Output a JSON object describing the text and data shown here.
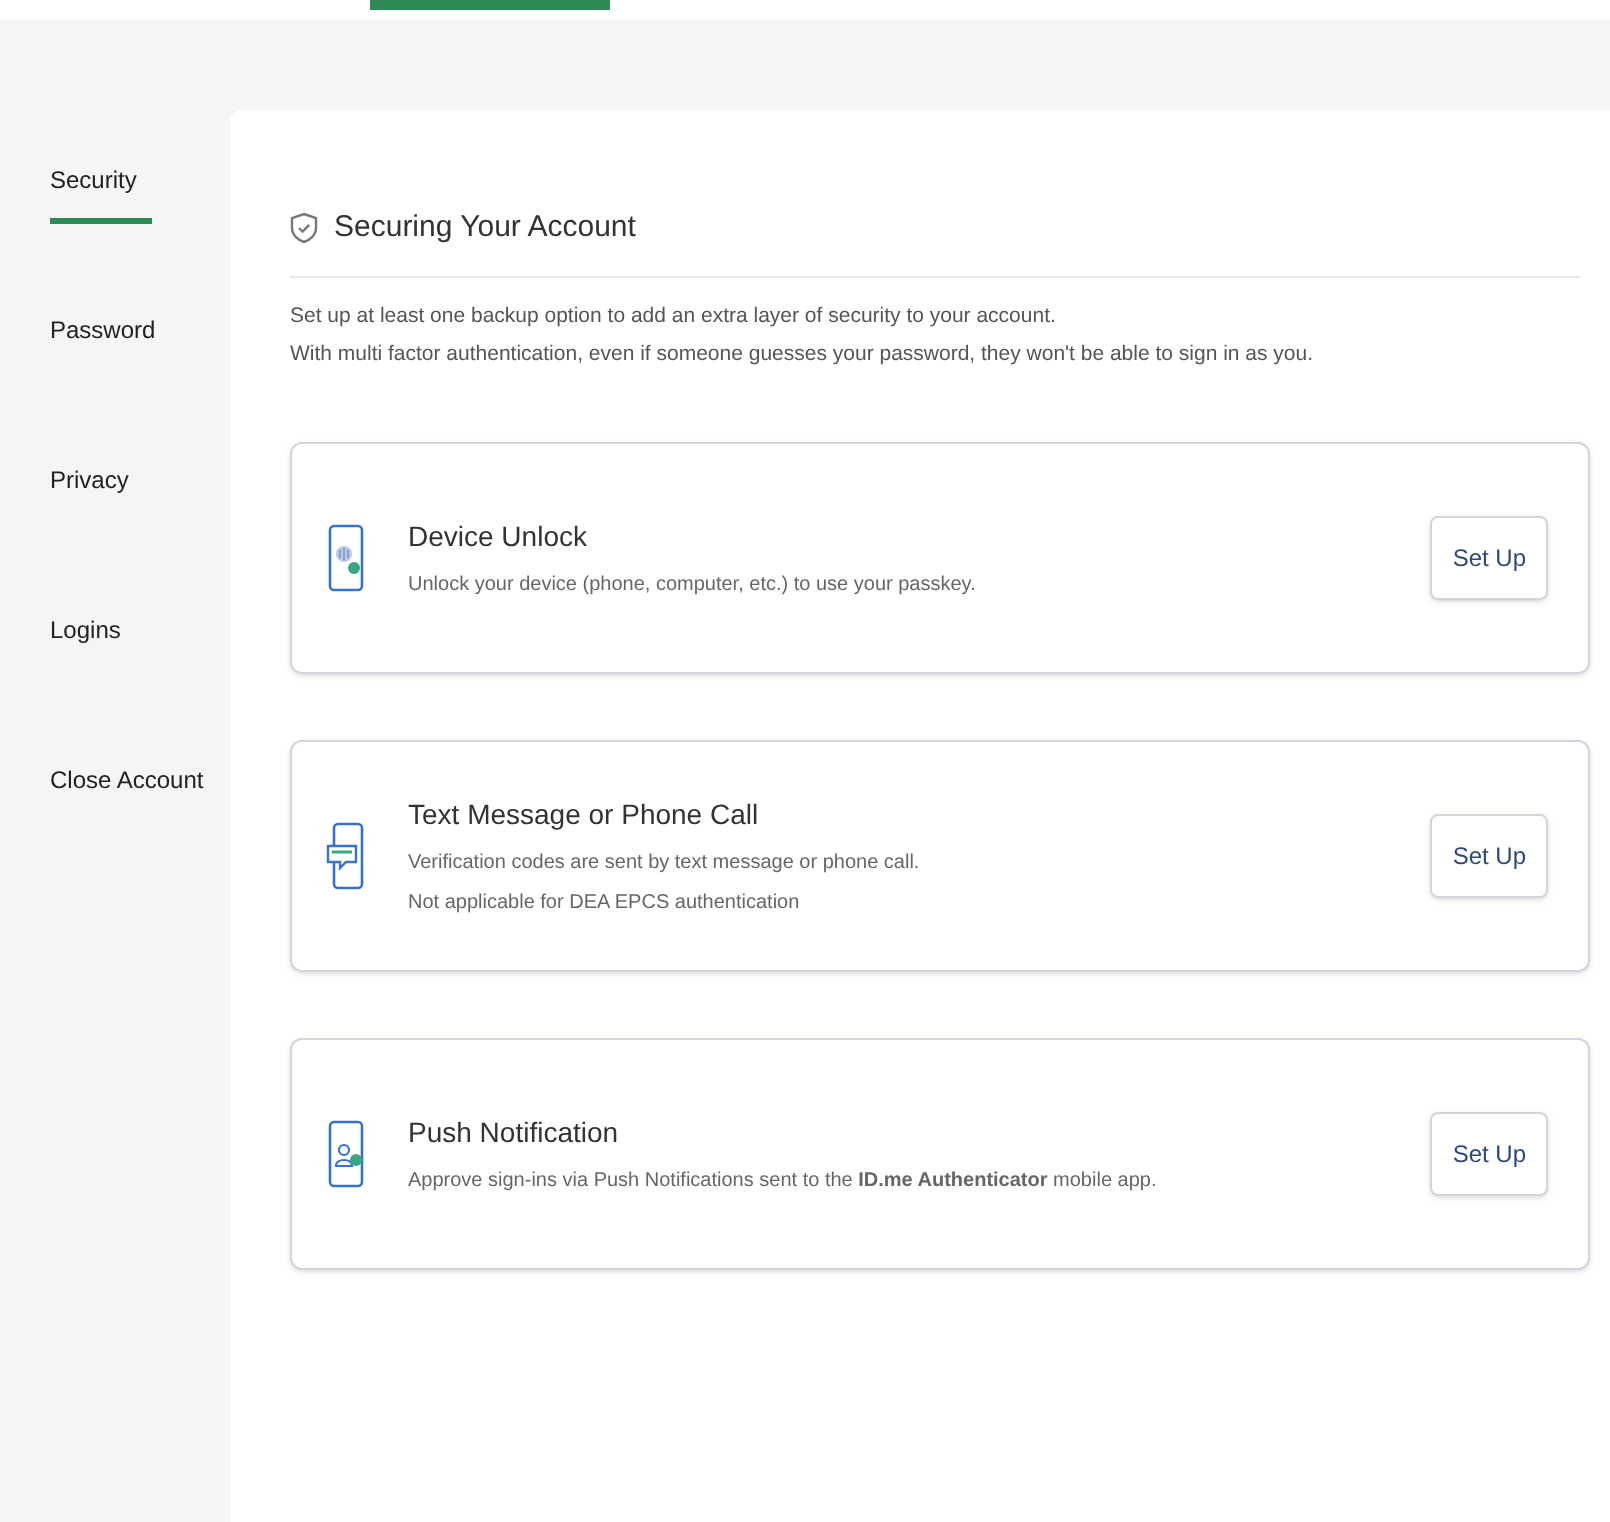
{
  "sidebar": {
    "items": [
      {
        "label": "Security",
        "selected": true
      },
      {
        "label": "Password",
        "selected": false
      },
      {
        "label": "Privacy",
        "selected": false
      },
      {
        "label": "Logins",
        "selected": false
      },
      {
        "label": "Close Account",
        "selected": false
      }
    ]
  },
  "section": {
    "title": "Securing Your Account",
    "intro": [
      "Set up at least one backup option to add an extra layer of security to your account.",
      "With multi factor authentication, even if someone guesses your password, they won't be able to sign in as you."
    ]
  },
  "options": [
    {
      "kind": "device",
      "title": "Device Unlock",
      "description": [
        "Unlock your device (phone, computer, etc.) to use your passkey."
      ],
      "button": "Set Up"
    },
    {
      "kind": "sms",
      "title": "Text Message or Phone Call",
      "description": [
        "Verification codes are sent by text message or phone call.",
        "Not applicable for DEA EPCS authentication"
      ],
      "button": "Set Up"
    },
    {
      "kind": "push",
      "title": "Push Notification",
      "description": [
        "Approve sign-ins via Push Notifications sent to the **ID.me Authenticator** mobile app."
      ],
      "button": "Set Up"
    }
  ]
}
